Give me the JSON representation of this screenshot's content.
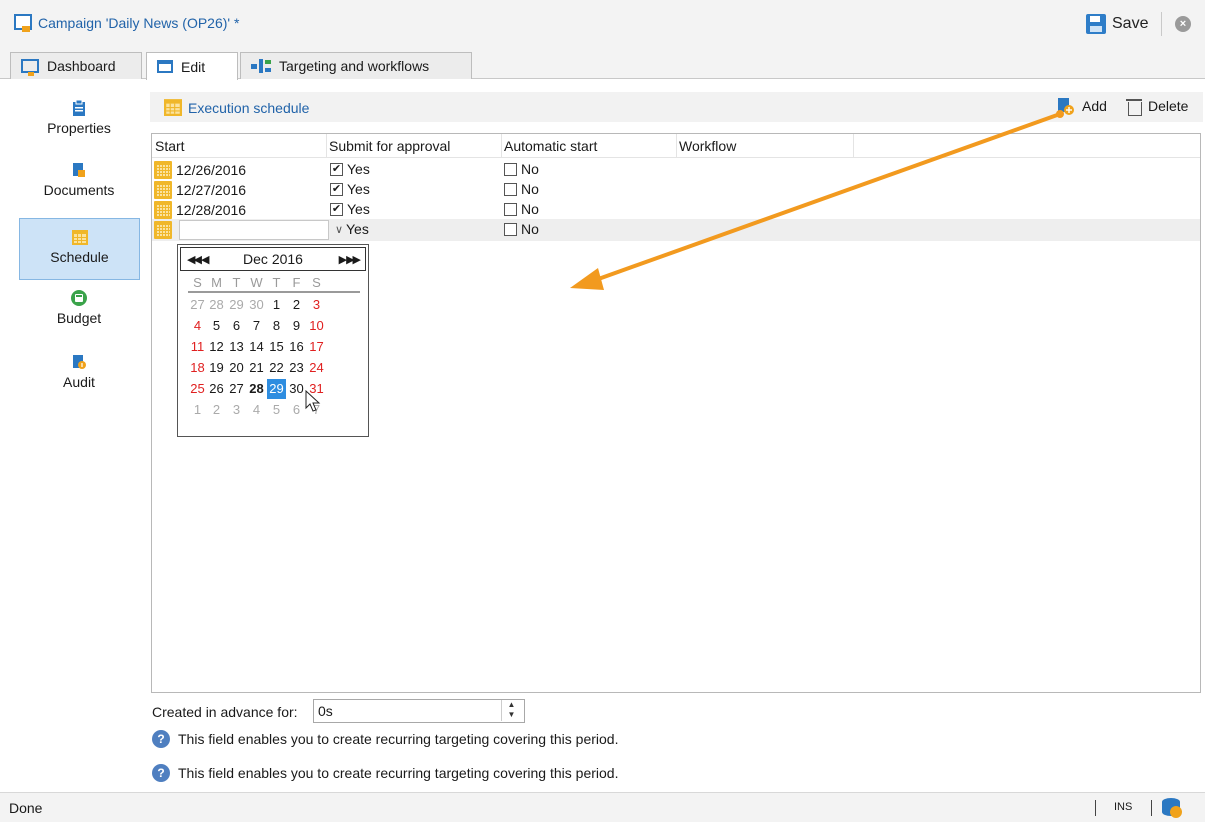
{
  "window": {
    "title": "Campaign 'Daily News (OP26)' *",
    "save_label": "Save"
  },
  "tabs": [
    {
      "label": "Dashboard",
      "active": false
    },
    {
      "label": "Edit",
      "active": true
    },
    {
      "label": "Targeting and workflows",
      "active": false
    }
  ],
  "sidebar": {
    "items": [
      {
        "label": "Properties",
        "icon": "clipboard-icon",
        "active": false
      },
      {
        "label": "Documents",
        "icon": "documents-icon",
        "active": false
      },
      {
        "label": "Schedule",
        "icon": "calendar-icon",
        "active": true
      },
      {
        "label": "Budget",
        "icon": "budget-icon",
        "active": false
      },
      {
        "label": "Audit",
        "icon": "audit-icon",
        "active": false
      }
    ]
  },
  "section": {
    "title": "Execution schedule",
    "add_label": "Add",
    "delete_label": "Delete"
  },
  "grid": {
    "columns": [
      "Start",
      "Submit for approval",
      "Automatic start",
      "Workflow"
    ],
    "rows": [
      {
        "start": "12/26/2016",
        "approval": "Yes",
        "approval_checked": true,
        "auto": "No",
        "auto_checked": false
      },
      {
        "start": "12/27/2016",
        "approval": "Yes",
        "approval_checked": true,
        "auto": "No",
        "auto_checked": false
      },
      {
        "start": "12/28/2016",
        "approval": "Yes",
        "approval_checked": true,
        "auto": "No",
        "auto_checked": false
      },
      {
        "start": "",
        "approval": "Yes",
        "approval_checked": false,
        "auto": "No",
        "auto_checked": false
      }
    ]
  },
  "calendar": {
    "month_label": "Dec 2016",
    "weekdays": [
      "S",
      "M",
      "T",
      "W",
      "T",
      "F",
      "S"
    ],
    "weeks": [
      [
        "27",
        "28",
        "29",
        "30",
        "1",
        "2",
        "3"
      ],
      [
        "4",
        "5",
        "6",
        "7",
        "8",
        "9",
        "10"
      ],
      [
        "11",
        "12",
        "13",
        "14",
        "15",
        "16",
        "17"
      ],
      [
        "18",
        "19",
        "20",
        "21",
        "22",
        "23",
        "24"
      ],
      [
        "25",
        "26",
        "27",
        "28",
        "29",
        "30",
        "31"
      ],
      [
        "1",
        "2",
        "3",
        "4",
        "5",
        "6",
        "7"
      ]
    ],
    "today": "28",
    "selected": "29"
  },
  "advance": {
    "label": "Created in advance for:",
    "value": "0s"
  },
  "help_text": "This field enables you to create recurring targeting covering this period.",
  "status": {
    "text": "Done",
    "ins": "INS"
  },
  "colors": {
    "accent": "#2163a9",
    "arrow": "#f29a1f",
    "selected_day": "#2e8de0",
    "weekend": "#e02020"
  }
}
